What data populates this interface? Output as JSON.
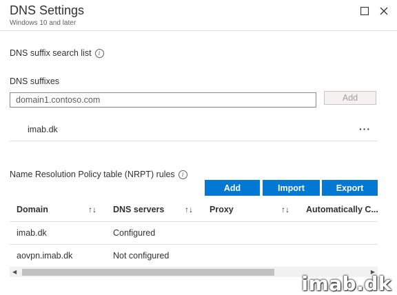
{
  "header": {
    "title": "DNS Settings",
    "subtitle": "Windows 10 and later"
  },
  "dns_suffix_search": {
    "label": "DNS suffix search list",
    "suffixes_label": "DNS suffixes",
    "input_placeholder": "domain1.contoso.com",
    "add_label": "Add",
    "items": [
      "imab.dk"
    ]
  },
  "nrpt": {
    "label": "Name Resolution Policy table (NRPT) rules",
    "buttons": {
      "add": "Add",
      "import": "Import",
      "export": "Export"
    },
    "columns": [
      "Domain",
      "DNS servers",
      "Proxy",
      "Automatically C..."
    ],
    "rows": [
      [
        "imab.dk",
        "Configured",
        "",
        ""
      ],
      [
        "aovpn.imab.dk",
        "Not configured",
        "",
        ""
      ]
    ]
  },
  "watermark": "imab.dk",
  "colors": {
    "primary": "#0078d4",
    "border": "#e1dfdd"
  }
}
